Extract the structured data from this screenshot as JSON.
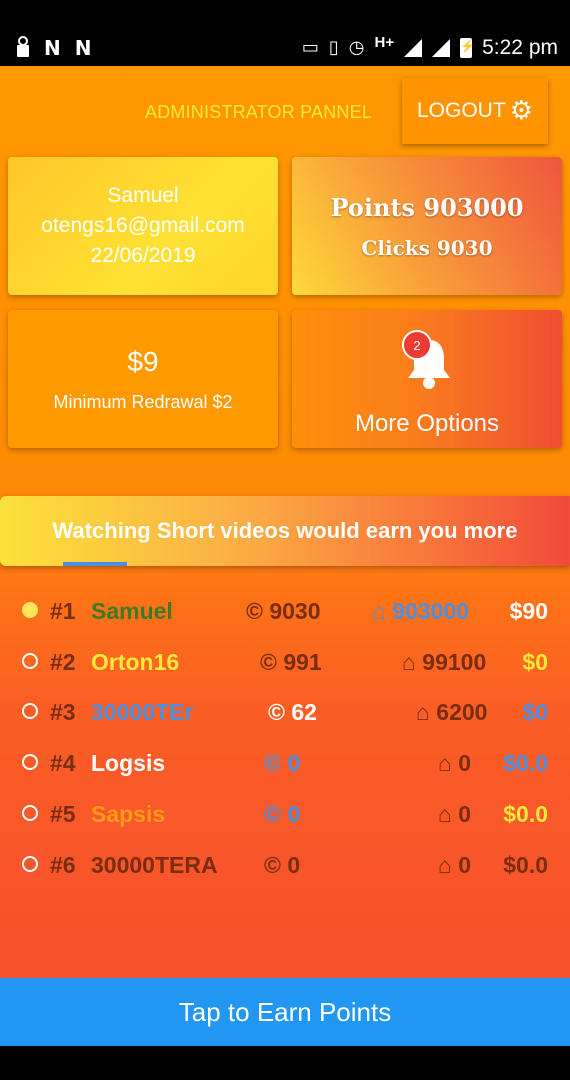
{
  "status_bar": {
    "left_icons": [
      "lock-icon",
      "n-notification-icon",
      "n-notification-icon"
    ],
    "left_glyphs": [
      "N",
      "N"
    ],
    "right_icons": [
      "cast-icon",
      "vibrate-icon",
      "alarm-icon",
      "signal-icon",
      "signal-icon",
      "battery-charging-icon"
    ],
    "network": "H+",
    "time": "5:22 pm"
  },
  "header": {
    "admin_label": "ADMINISTRATOR PANNEL",
    "logout_label": "LOGOUT",
    "logout_icon": "gear-icon"
  },
  "user_card": {
    "name": "Samuel",
    "email": "otengs16@gmail.com",
    "date": "22/06/2019"
  },
  "points_card": {
    "points": "Points 903000",
    "clicks": "Clicks 9030"
  },
  "money_card": {
    "amount": "$9",
    "minimum": "Minimum Redrawal $2"
  },
  "more_card": {
    "badge": "2",
    "label": "More Options",
    "icon": "bell-icon"
  },
  "banner": {
    "text": "Watching Short videos would earn you more"
  },
  "leaderboard": [
    {
      "rank": "#1",
      "name": "Samuel",
      "clicks": "© 9030",
      "points": "⌂ 903000",
      "money": "$90",
      "active": true,
      "colors": {
        "name": "#3d7a26",
        "clicks": "#7a2d12",
        "points": "#4a8fe0",
        "money": "#ffffff"
      }
    },
    {
      "rank": "#2",
      "name": "Orton16",
      "clicks": "© 991",
      "points": "⌂ 99100",
      "money": "$0",
      "active": false,
      "colors": {
        "name": "#ffe93a",
        "clicks": "#7a2d12",
        "points": "#7a2d12",
        "money": "#ffe93a"
      }
    },
    {
      "rank": "#3",
      "name": "30000TEr",
      "clicks": "© 62",
      "points": "⌂ 6200",
      "money": "$0",
      "active": false,
      "colors": {
        "name": "#4a8fe0",
        "clicks": "#ffffff",
        "points": "#7a2d12",
        "money": "#4a8fe0"
      }
    },
    {
      "rank": "#4",
      "name": "Logsis",
      "clicks": "© 0",
      "points": "⌂ 0",
      "money": "$0.0",
      "active": false,
      "colors": {
        "name": "#ffffff",
        "clicks": "#4a8fe0",
        "points": "#7a2d12",
        "money": "#4a8fe0"
      }
    },
    {
      "rank": "#5",
      "name": "Sapsis",
      "clicks": "© 0",
      "points": "⌂ 0",
      "money": "$0.0",
      "active": false,
      "colors": {
        "name": "#ff9a1a",
        "clicks": "#4a8fe0",
        "points": "#7a2d12",
        "money": "#ffe93a"
      }
    },
    {
      "rank": "#6",
      "name": "30000TERA",
      "clicks": "© 0",
      "points": "⌂ 0",
      "money": "$0.0",
      "active": false,
      "colors": {
        "name": "#7a2d12",
        "clicks": "#7a2d12",
        "points": "#7a2d12",
        "money": "#7a2d12"
      }
    }
  ],
  "cta": {
    "label": "Tap to Earn Points"
  },
  "colors": {
    "app_orange": "#ff9900",
    "app_red": "#f6502c",
    "accent_yellow": "#ffe933",
    "cta_blue": "#2196f3",
    "badge_red": "#ee3b32",
    "indicator_blue": "#4a90e2"
  }
}
